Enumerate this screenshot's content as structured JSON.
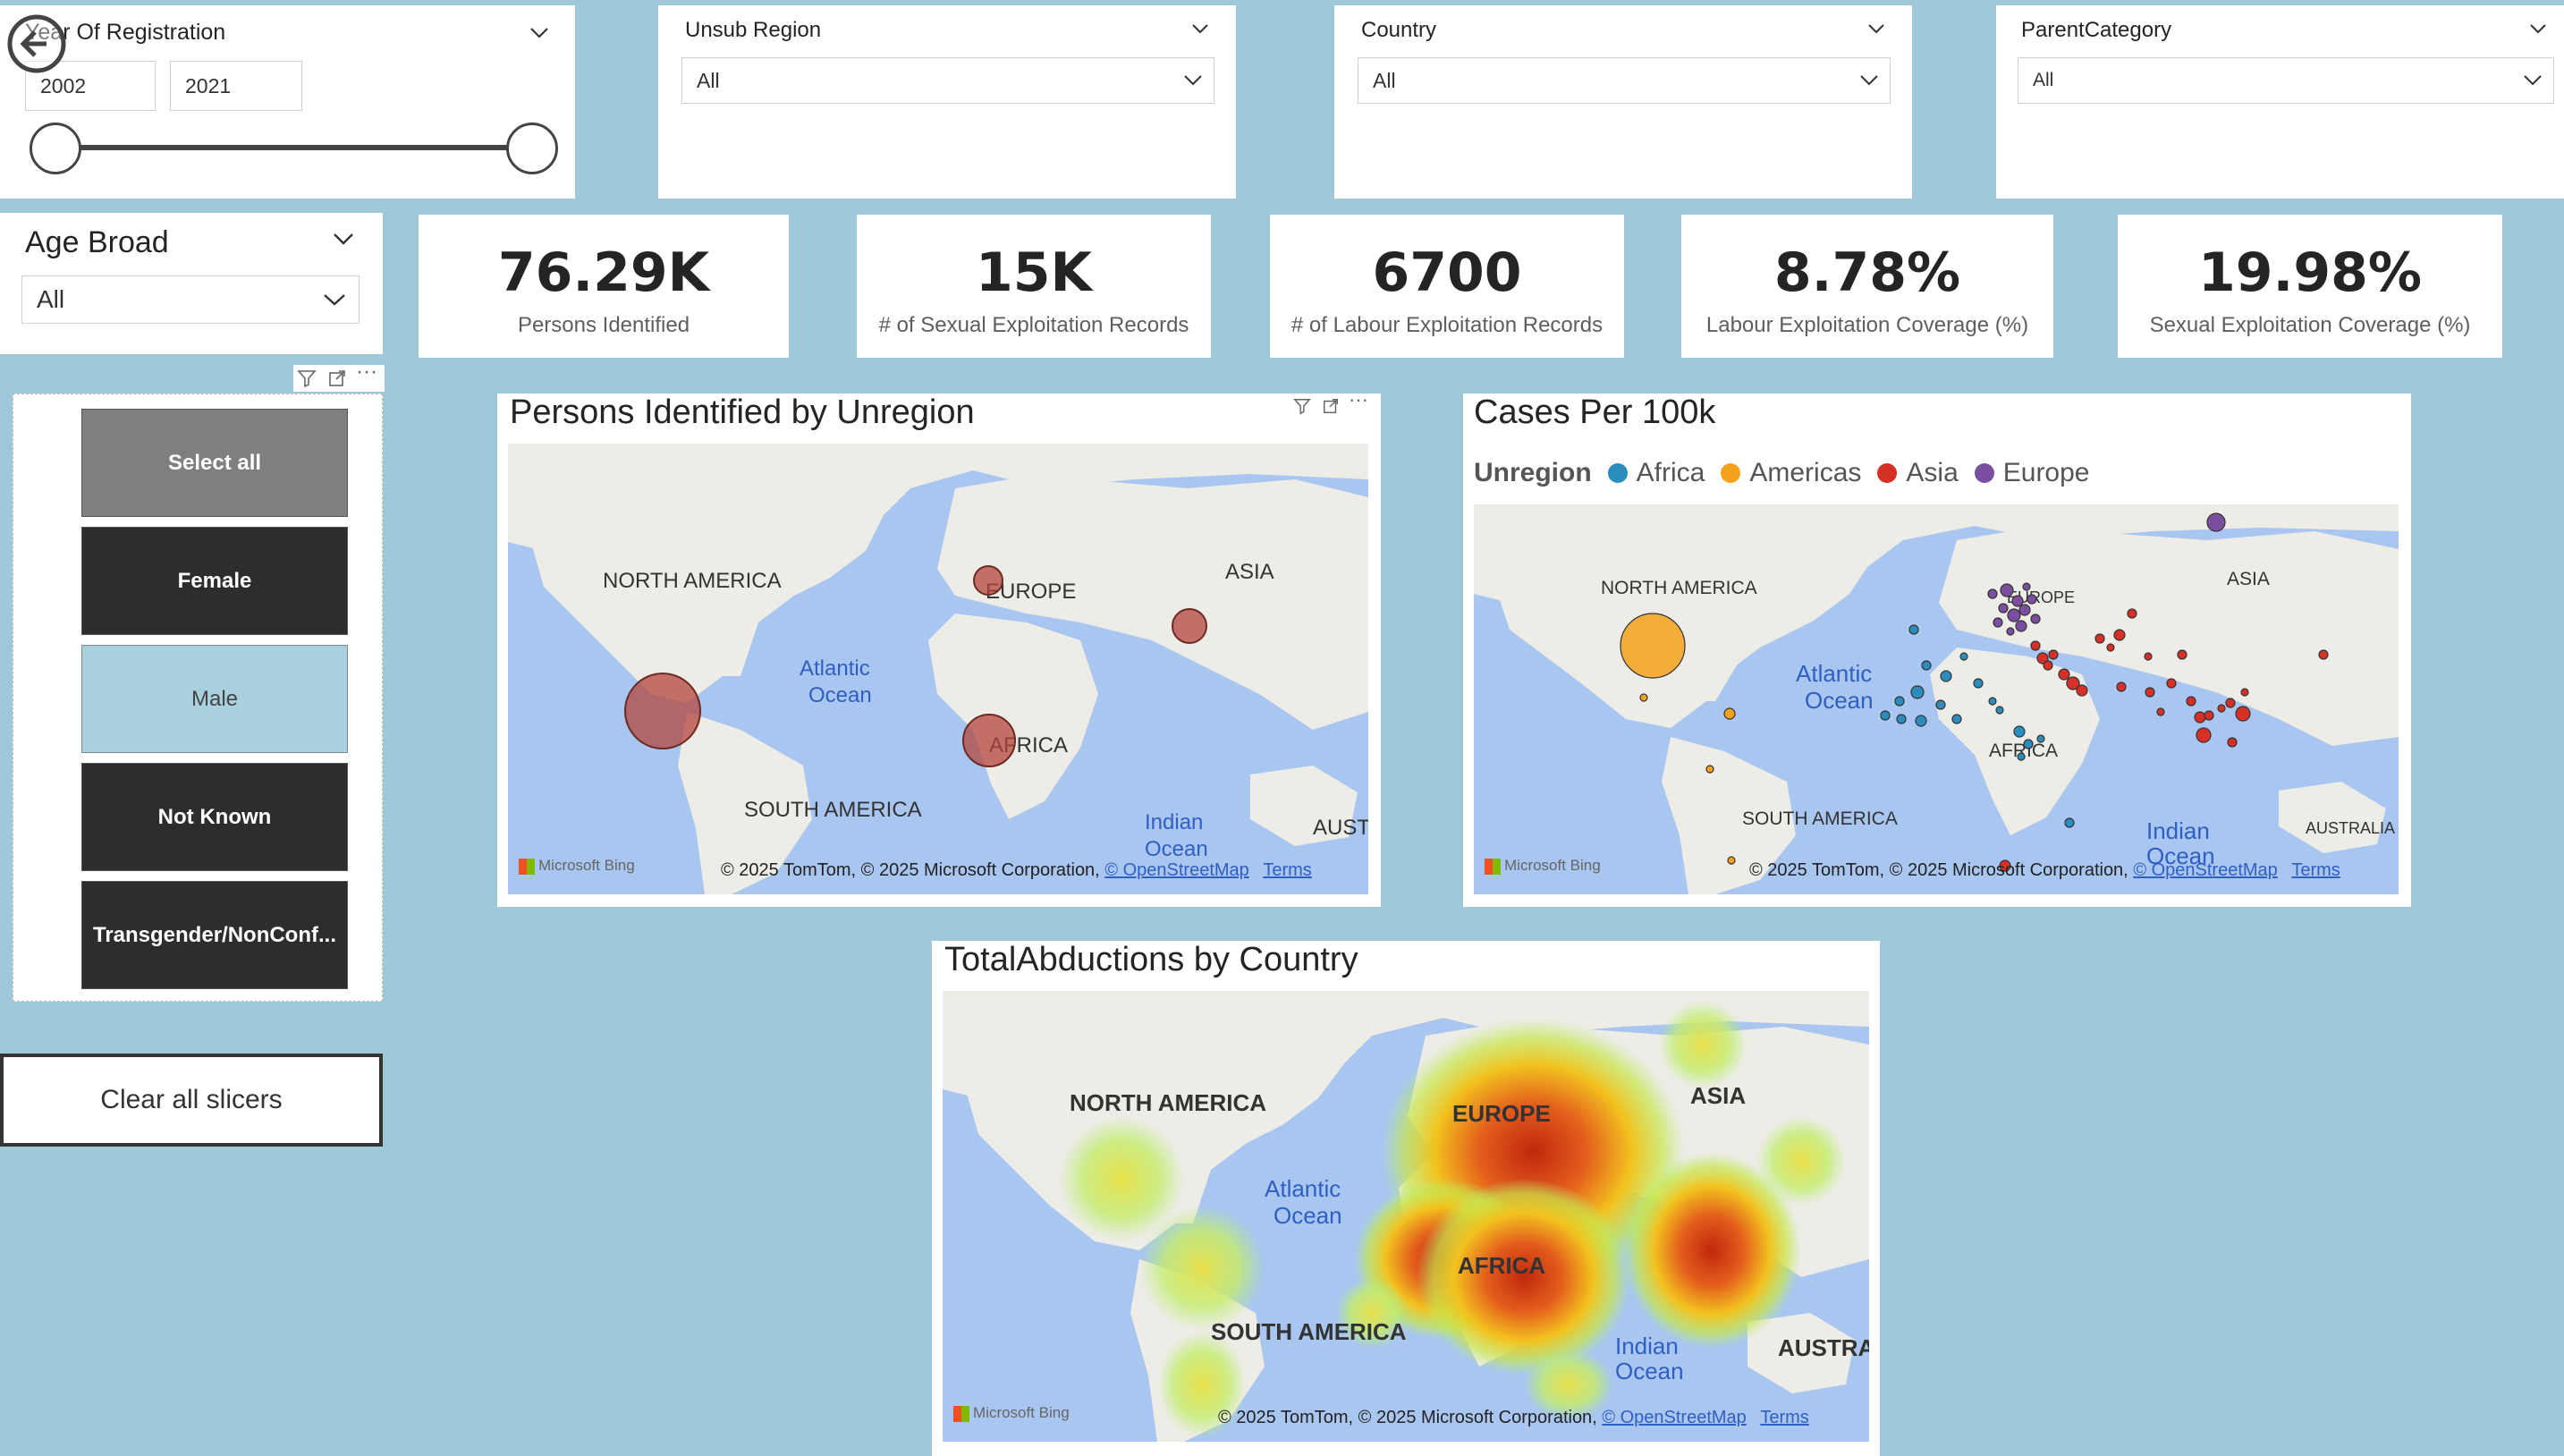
{
  "year_slicer": {
    "title": "Year Of Registration",
    "from": "2002",
    "to": "2021"
  },
  "dropdowns": [
    {
      "title": "Unsub Region",
      "value": "All"
    },
    {
      "title": "Country",
      "value": "All"
    },
    {
      "title": "ParentCategory",
      "value": "All"
    }
  ],
  "age_broad": {
    "title": "Age Broad",
    "value": "All"
  },
  "kpis": [
    {
      "value": "76.29K",
      "label": "Persons Identified"
    },
    {
      "value": "15K",
      "label": "# of Sexual Exploitation Records"
    },
    {
      "value": "6700",
      "label": "# of Labour Exploitation Records"
    },
    {
      "value": "8.78%",
      "label": "Labour Exploitation Coverage (%)"
    },
    {
      "value": "19.98%",
      "label": "Sexual Exploitation Coverage (%)"
    }
  ],
  "gender_slicer": {
    "items": [
      {
        "label": "Select all",
        "state": "partial"
      },
      {
        "label": "Female",
        "state": "dark"
      },
      {
        "label": "Male",
        "state": "selected"
      },
      {
        "label": "Not Known",
        "state": "dark"
      },
      {
        "label": "Transgender/NonConf...",
        "state": "dark"
      }
    ]
  },
  "clear_button": "Clear all slicers",
  "map1": {
    "title": "Persons Identified by Unregion",
    "labels": {
      "north_america": "NORTH AMERICA",
      "europe": "EUROPE",
      "asia": "ASIA",
      "africa": "AFRICA",
      "south_america": "SOUTH AMERICA",
      "atlantic": "Atlantic",
      "ocean": "Ocean",
      "indian": "Indian",
      "indian_ocean": "Ocean",
      "australia": "AUSTI"
    },
    "attribution": "© 2025 TomTom, © 2025 Microsoft Corporation,",
    "osm": "© OpenStreetMap",
    "terms": "Terms",
    "bing": "Microsoft Bing"
  },
  "map2": {
    "title": "Cases Per 100k",
    "legend_title": "Unregion",
    "legend": [
      {
        "name": "Africa",
        "color": "#2b8cbe"
      },
      {
        "name": "Americas",
        "color": "#f4a11c"
      },
      {
        "name": "Asia",
        "color": "#d73027"
      },
      {
        "name": "Europe",
        "color": "#7b4fa0"
      }
    ],
    "labels": {
      "north_america": "NORTH AMERICA",
      "europe": "EUROPE",
      "asia": "ASIA",
      "africa": "AFRICA",
      "south_america": "SOUTH AMERICA",
      "atlantic": "Atlantic",
      "ocean": "Ocean",
      "indian": "Indian",
      "indian_ocean": "Ocean",
      "australia": "AUSTRALIA"
    },
    "attribution": "© 2025 TomTom, © 2025 Microsoft Corporation,",
    "osm": "© OpenStreetMap",
    "terms": "Terms",
    "bing": "Microsoft Bing"
  },
  "map3": {
    "title": "TotalAbductions by Country",
    "labels": {
      "north_america": "NORTH AMERICA",
      "europe": "EUROPE",
      "asia": "ASIA",
      "africa": "AFRICA",
      "south_america": "SOUTH AMERICA",
      "atlantic": "Atlantic",
      "ocean": "Ocean",
      "indian": "Indian",
      "indian_ocean": "Ocean",
      "australia": "AUSTRA"
    },
    "attribution": "© 2025 TomTom, © 2025 Microsoft Corporation,",
    "osm": "© OpenStreetMap",
    "terms": "Terms",
    "bing": "Microsoft Bing"
  },
  "colors": {
    "bg": "#9fc8d9",
    "dark_button": "#2d2d2d",
    "selected_button": "#a8d0de",
    "partial_button": "#7f7f7f",
    "ocean": "#a8c6f0",
    "land": "#eeece6"
  }
}
